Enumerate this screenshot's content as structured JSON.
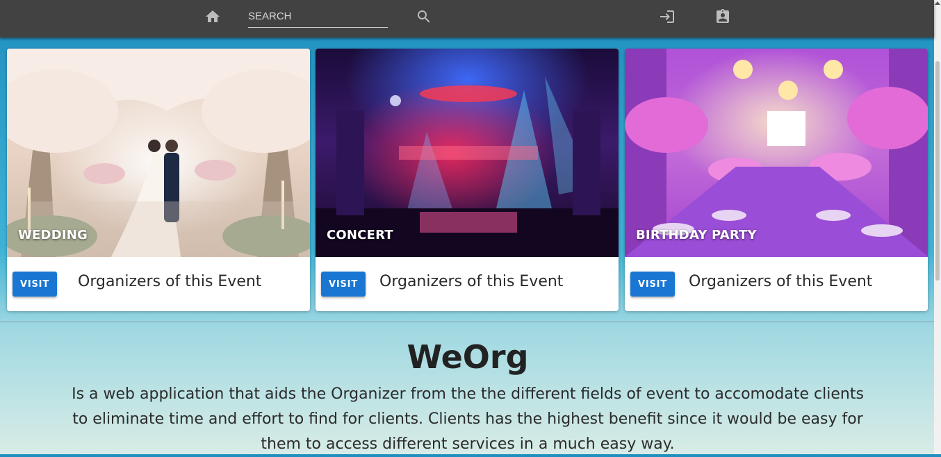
{
  "nav": {
    "search_placeholder": "SEARCH",
    "icons": [
      "home-icon",
      "search-icon",
      "login-icon",
      "assignment-ind-icon"
    ],
    "icon_color": "#bdbdbd",
    "bar_color": "#424242"
  },
  "cards": [
    {
      "title": "WEDDING",
      "button_label": "VISIT",
      "text": "Organizers of this Event"
    },
    {
      "title": "CONCERT",
      "button_label": "VISIT",
      "text": "Organizers of this Event"
    },
    {
      "title": "BIRTHDAY PARTY",
      "button_label": "VISIT",
      "text": "Organizers of this Event"
    }
  ],
  "accent_color": "#1976d2",
  "about": {
    "heading": "WeOrg",
    "description": "Is a web application that aids the Organizer from the the different fields of event to accomodate clients to eliminate time and effort to find for clients. Clients has the highest benefit since it would be easy for them to access different services in a much easy way."
  }
}
